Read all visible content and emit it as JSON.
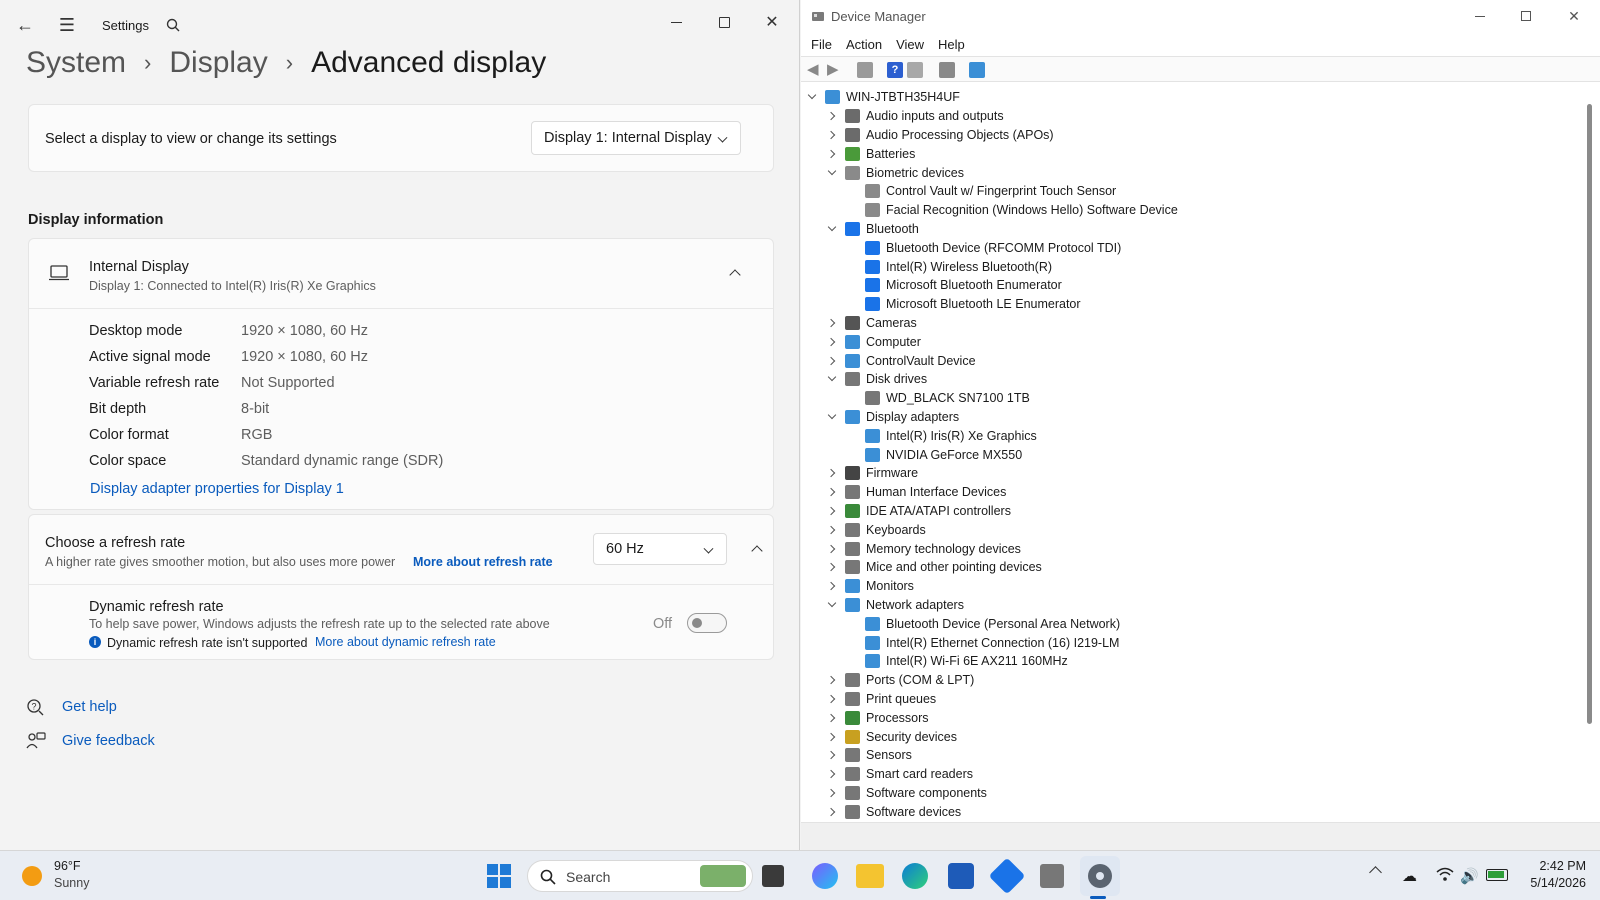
{
  "settings": {
    "app_title": "Settings",
    "breadcrumb": [
      "System",
      "Display",
      "Advanced display"
    ],
    "select_display": {
      "label": "Select a display to view or change its settings",
      "value": "Display 1: Internal Display"
    },
    "section_title": "Display information",
    "display": {
      "name": "Internal Display",
      "connection": "Display 1: Connected to Intel(R) Iris(R) Xe Graphics",
      "rows": [
        {
          "label": "Desktop mode",
          "value": "1920 × 1080, 60 Hz"
        },
        {
          "label": "Active signal mode",
          "value": "1920 × 1080, 60 Hz"
        },
        {
          "label": "Variable refresh rate",
          "value": "Not Supported"
        },
        {
          "label": "Bit depth",
          "value": "8-bit"
        },
        {
          "label": "Color format",
          "value": "RGB"
        },
        {
          "label": "Color space",
          "value": "Standard dynamic range (SDR)"
        }
      ],
      "adapter_link": "Display adapter properties for Display 1"
    },
    "refresh": {
      "title": "Choose a refresh rate",
      "desc": "A higher rate gives smoother motion, but also uses more power",
      "link": "More about refresh rate",
      "value": "60 Hz",
      "dynamic_title": "Dynamic refresh rate",
      "dynamic_desc": "To help save power, Windows adjusts the refresh rate up to the selected rate above",
      "dynamic_note": "Dynamic refresh rate isn't supported",
      "dynamic_link": "More about dynamic refresh rate",
      "toggle_state": "Off"
    },
    "help": [
      "Get help",
      "Give feedback"
    ]
  },
  "devmgr": {
    "title": "Device Manager",
    "menu": [
      "File",
      "Action",
      "View",
      "Help"
    ],
    "root": "WIN-JTBTH35H4UF",
    "tree": [
      {
        "label": "Audio inputs and outputs",
        "level": 1,
        "state": "collapsed",
        "icon": "speaker-icon",
        "color": "#6b6b6b"
      },
      {
        "label": "Audio Processing Objects (APOs)",
        "level": 1,
        "state": "collapsed",
        "icon": "speaker-icon",
        "color": "#6b6b6b"
      },
      {
        "label": "Batteries",
        "level": 1,
        "state": "collapsed",
        "icon": "battery-icon",
        "color": "#4a9a3a"
      },
      {
        "label": "Biometric devices",
        "level": 1,
        "state": "expanded",
        "icon": "fingerprint-icon",
        "color": "#8a8a8a"
      },
      {
        "label": "Control Vault w/ Fingerprint Touch Sensor",
        "level": 2,
        "state": "leaf",
        "icon": "fingerprint-icon",
        "color": "#8a8a8a"
      },
      {
        "label": "Facial Recognition (Windows Hello) Software Device",
        "level": 2,
        "state": "leaf",
        "icon": "fingerprint-icon",
        "color": "#8a8a8a"
      },
      {
        "label": "Bluetooth",
        "level": 1,
        "state": "expanded",
        "icon": "bluetooth-icon",
        "color": "#1a73e8"
      },
      {
        "label": "Bluetooth Device (RFCOMM Protocol TDI)",
        "level": 2,
        "state": "leaf",
        "icon": "bluetooth-icon",
        "color": "#1a73e8"
      },
      {
        "label": "Intel(R) Wireless Bluetooth(R)",
        "level": 2,
        "state": "leaf",
        "icon": "bluetooth-icon",
        "color": "#1a73e8"
      },
      {
        "label": "Microsoft Bluetooth Enumerator",
        "level": 2,
        "state": "leaf",
        "icon": "bluetooth-icon",
        "color": "#1a73e8"
      },
      {
        "label": "Microsoft Bluetooth LE Enumerator",
        "level": 2,
        "state": "leaf",
        "icon": "bluetooth-icon",
        "color": "#1a73e8"
      },
      {
        "label": "Cameras",
        "level": 1,
        "state": "collapsed",
        "icon": "camera-icon",
        "color": "#555555"
      },
      {
        "label": "Computer",
        "level": 1,
        "state": "collapsed",
        "icon": "computer-icon",
        "color": "#3b8fd6"
      },
      {
        "label": "ControlVault Device",
        "level": 1,
        "state": "collapsed",
        "icon": "computer-icon",
        "color": "#3b8fd6"
      },
      {
        "label": "Disk drives",
        "level": 1,
        "state": "expanded",
        "icon": "disk-icon",
        "color": "#777777"
      },
      {
        "label": "WD_BLACK SN7100 1TB",
        "level": 2,
        "state": "leaf",
        "icon": "disk-icon",
        "color": "#777777"
      },
      {
        "label": "Display adapters",
        "level": 1,
        "state": "expanded",
        "icon": "monitor-icon",
        "color": "#3b8fd6"
      },
      {
        "label": "Intel(R) Iris(R) Xe Graphics",
        "level": 2,
        "state": "leaf",
        "icon": "monitor-icon",
        "color": "#3b8fd6"
      },
      {
        "label": "NVIDIA GeForce MX550",
        "level": 2,
        "state": "leaf",
        "icon": "monitor-icon",
        "color": "#3b8fd6"
      },
      {
        "label": "Firmware",
        "level": 1,
        "state": "collapsed",
        "icon": "chip-icon",
        "color": "#444444"
      },
      {
        "label": "Human Interface Devices",
        "level": 1,
        "state": "collapsed",
        "icon": "hid-icon",
        "color": "#777777"
      },
      {
        "label": "IDE ATA/ATAPI controllers",
        "level": 1,
        "state": "collapsed",
        "icon": "controller-icon",
        "color": "#3a8a3a"
      },
      {
        "label": "Keyboards",
        "level": 1,
        "state": "collapsed",
        "icon": "keyboard-icon",
        "color": "#777777"
      },
      {
        "label": "Memory technology devices",
        "level": 1,
        "state": "collapsed",
        "icon": "memory-icon",
        "color": "#777777"
      },
      {
        "label": "Mice and other pointing devices",
        "level": 1,
        "state": "collapsed",
        "icon": "mouse-icon",
        "color": "#777777"
      },
      {
        "label": "Monitors",
        "level": 1,
        "state": "collapsed",
        "icon": "monitor-icon",
        "color": "#3b8fd6"
      },
      {
        "label": "Network adapters",
        "level": 1,
        "state": "expanded",
        "icon": "network-icon",
        "color": "#3b8fd6"
      },
      {
        "label": "Bluetooth Device (Personal Area Network)",
        "level": 2,
        "state": "leaf",
        "icon": "network-icon",
        "color": "#3b8fd6"
      },
      {
        "label": "Intel(R) Ethernet Connection (16) I219-LM",
        "level": 2,
        "state": "leaf",
        "icon": "network-icon",
        "color": "#3b8fd6"
      },
      {
        "label": "Intel(R) Wi-Fi 6E AX211 160MHz",
        "level": 2,
        "state": "leaf",
        "icon": "network-icon",
        "color": "#3b8fd6"
      },
      {
        "label": "Ports (COM & LPT)",
        "level": 1,
        "state": "collapsed",
        "icon": "port-icon",
        "color": "#777777"
      },
      {
        "label": "Print queues",
        "level": 1,
        "state": "collapsed",
        "icon": "printer-icon",
        "color": "#777777"
      },
      {
        "label": "Processors",
        "level": 1,
        "state": "collapsed",
        "icon": "processor-icon",
        "color": "#3a8a3a"
      },
      {
        "label": "Security devices",
        "level": 1,
        "state": "collapsed",
        "icon": "security-icon",
        "color": "#c8a020"
      },
      {
        "label": "Sensors",
        "level": 1,
        "state": "collapsed",
        "icon": "sensor-icon",
        "color": "#777777"
      },
      {
        "label": "Smart card readers",
        "level": 1,
        "state": "collapsed",
        "icon": "smartcard-icon",
        "color": "#777777"
      },
      {
        "label": "Software components",
        "level": 1,
        "state": "collapsed",
        "icon": "component-icon",
        "color": "#777777"
      },
      {
        "label": "Software devices",
        "level": 1,
        "state": "collapsed",
        "icon": "component-icon",
        "color": "#777777"
      }
    ]
  },
  "taskbar": {
    "weather_temp": "96°F",
    "weather_desc": "Sunny",
    "search_placeholder": "Search",
    "time": "2:42 PM",
    "date": "5/14/2026"
  }
}
